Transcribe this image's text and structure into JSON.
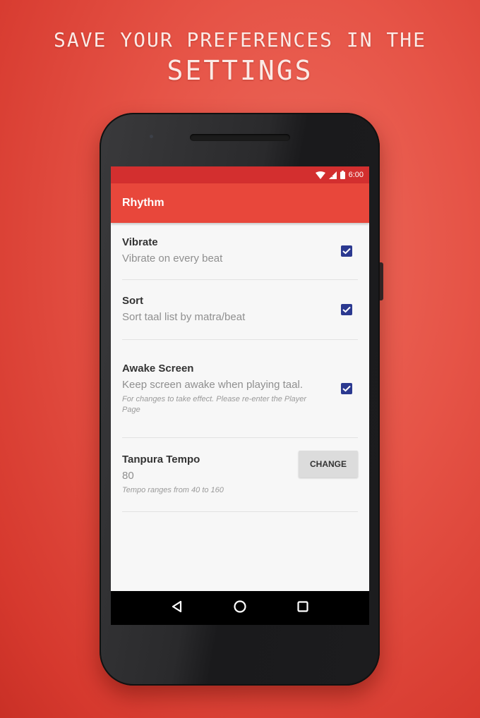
{
  "headline": {
    "line1": "SAVE YOUR PREFERENCES IN THE",
    "line2": "SETTINGS"
  },
  "status_bar": {
    "time": "6:00",
    "icons": [
      "wifi-icon",
      "cell-signal-icon",
      "battery-icon"
    ]
  },
  "app_bar": {
    "title": "Rhythm"
  },
  "preferences": [
    {
      "title": "Vibrate",
      "summary": "Vibrate on every beat",
      "checked": true
    },
    {
      "title": "Sort",
      "summary": "Sort taal list by matra/beat",
      "checked": true
    },
    {
      "title": "Awake Screen",
      "summary": "Keep screen awake when playing taal.",
      "note": "For changes to take effect. Please re-enter the Player Page",
      "checked": true
    }
  ],
  "tempo": {
    "title": "Tanpura Tempo",
    "value": "80",
    "note": "Tempo ranges from 40 to 160",
    "button_label": "CHANGE"
  },
  "nav_bar": {
    "buttons": [
      "back",
      "home",
      "recents"
    ]
  },
  "colors": {
    "background": "#e65447",
    "status_bar": "#d32f2f",
    "app_bar": "#e8473b",
    "checkbox": "#2b3990"
  }
}
